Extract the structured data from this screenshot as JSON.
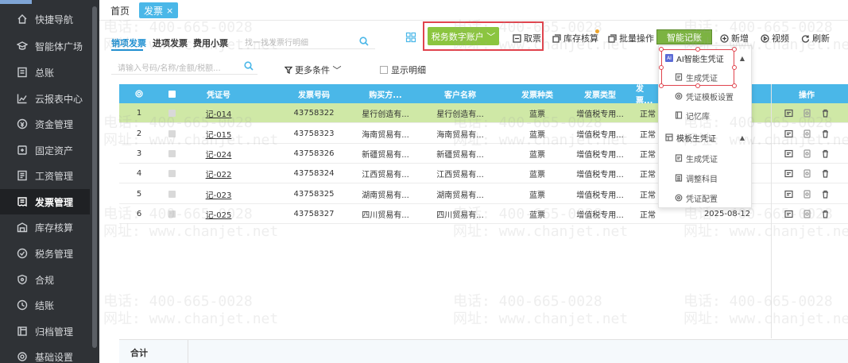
{
  "sidebar": {
    "items": [
      {
        "label": "快捷导航",
        "icon": "home-icon"
      },
      {
        "label": "智能体广场",
        "icon": "graduation-cap-icon"
      },
      {
        "label": "总账",
        "icon": "ledger-icon"
      },
      {
        "label": "云报表中心",
        "icon": "chart-line-icon"
      },
      {
        "label": "资金管理",
        "icon": "coin-icon"
      },
      {
        "label": "固定资产",
        "icon": "asset-icon"
      },
      {
        "label": "工资管理",
        "icon": "salary-icon"
      },
      {
        "label": "发票管理",
        "icon": "invoice-icon",
        "active": true
      },
      {
        "label": "库存核算",
        "icon": "warehouse-icon"
      },
      {
        "label": "税务管理",
        "icon": "tax-icon"
      },
      {
        "label": "合规",
        "icon": "shield-icon"
      },
      {
        "label": "结账",
        "icon": "checkout-icon"
      },
      {
        "label": "归档管理",
        "icon": "archive-icon"
      },
      {
        "label": "基础设置",
        "icon": "settings-icon"
      }
    ]
  },
  "tabs": {
    "home": "首页",
    "invoice": "发票",
    "close": "×"
  },
  "subtabs": [
    "销项发票",
    "进项发票",
    "费用小票"
  ],
  "search1": {
    "placeholder": "找一找发票行明细"
  },
  "toolbar": {
    "tax_account": "税务数字账户 ﹀",
    "fetch": "取票",
    "inventory": "库存核算",
    "batch": "批量操作",
    "smart_voucher": "智能记账",
    "add": "新增",
    "video": "视频",
    "refresh": "刷新"
  },
  "filter": {
    "search_placeholder": "请输入号码/名称/金额/税额...",
    "more_conditions": "更多条件 ﹀",
    "show_detail": "显示明细"
  },
  "table": {
    "headers": [
      "凭证号",
      "发票号码",
      "购买方...",
      "客户名称",
      "发票种类",
      "发票类型",
      "发票...",
      "操作"
    ],
    "rows": [
      {
        "idx": "1",
        "voucher": "记-014",
        "number": "43758322",
        "buyer": "星行创造有...",
        "customer": "星行创造有...",
        "kind": "蓝票",
        "type": "增值税专用...",
        "status": "正常",
        "date": ""
      },
      {
        "idx": "2",
        "voucher": "记-015",
        "number": "43758323",
        "buyer": "海南贸易有...",
        "customer": "海南贸易有...",
        "kind": "蓝票",
        "type": "增值税专用...",
        "status": "正常",
        "date": ""
      },
      {
        "idx": "3",
        "voucher": "记-024",
        "number": "43758326",
        "buyer": "新疆贸易有...",
        "customer": "新疆贸易有...",
        "kind": "蓝票",
        "type": "增值税专用...",
        "status": "正常",
        "date": ""
      },
      {
        "idx": "4",
        "voucher": "记-022",
        "number": "43758324",
        "buyer": "江西贸易有...",
        "customer": "江西贸易有...",
        "kind": "蓝票",
        "type": "增值税专用...",
        "status": "正常",
        "date": ""
      },
      {
        "idx": "5",
        "voucher": "记-023",
        "number": "43758325",
        "buyer": "湖南贸易有...",
        "customer": "湖南贸易有...",
        "kind": "蓝票",
        "type": "增值税专用...",
        "status": "正常",
        "date": ""
      },
      {
        "idx": "6",
        "voucher": "记-025",
        "number": "43758327",
        "buyer": "四川贸易有...",
        "customer": "四川贸易有...",
        "kind": "蓝票",
        "type": "增值税专用...",
        "status": "正常",
        "date": "2025-08-12"
      }
    ],
    "total_label": "合计"
  },
  "dropdown": {
    "ai_group": "AI智能生凭证",
    "ai_badge": "AI",
    "ai_generate": "生成凭证",
    "template_settings": "凭证模板设置",
    "memory": "记忆库",
    "template_group": "模板生凭证",
    "template_generate": "生成凭证",
    "adjust_subject": "调整科目",
    "voucher_config": "凭证配置",
    "caret": "▲"
  },
  "watermark": {
    "phone": "电话: 400-665-0028",
    "site": "网址: www.chanjet.net"
  },
  "colors": {
    "accent": "#4ab7e8",
    "green": "#8bc53f",
    "highlight_row": "#cfe8a6",
    "red_frame": "#e0434d",
    "sidebar": "#2f3236"
  }
}
